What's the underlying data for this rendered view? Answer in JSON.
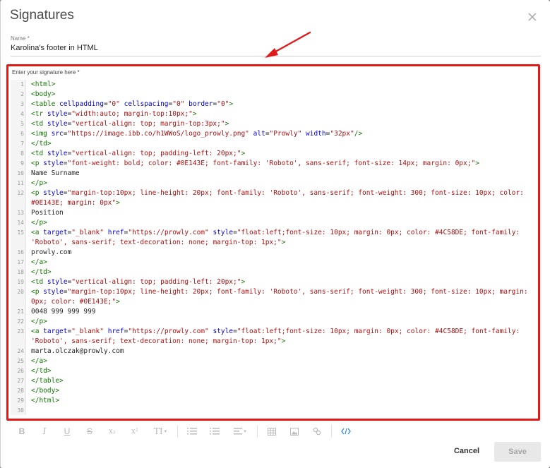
{
  "dialog": {
    "title": "Signatures",
    "name_label": "Name *",
    "name_value": "Karolina's footer in HTML",
    "signature_label": "Enter your signature here *"
  },
  "colors": {
    "highlight": "#e11919",
    "tag": "#117700",
    "attr": "#0000cc",
    "string": "#aa1111",
    "active_tool": "#3c8ee0"
  },
  "code": [
    {
      "n": "1",
      "parts": [
        {
          "k": "t",
          "v": "<html>"
        }
      ]
    },
    {
      "n": "2",
      "parts": [
        {
          "k": "t",
          "v": "<body>"
        }
      ]
    },
    {
      "n": "3",
      "parts": [
        {
          "k": "t",
          "v": "<table "
        },
        {
          "k": "a",
          "v": "cellpadding"
        },
        {
          "k": "",
          "v": "="
        },
        {
          "k": "s",
          "v": "\"0\""
        },
        {
          "k": "",
          "v": " "
        },
        {
          "k": "a",
          "v": "cellspacing"
        },
        {
          "k": "",
          "v": "="
        },
        {
          "k": "s",
          "v": "\"0\""
        },
        {
          "k": "",
          "v": " "
        },
        {
          "k": "a",
          "v": "border"
        },
        {
          "k": "",
          "v": "="
        },
        {
          "k": "s",
          "v": "\"0\""
        },
        {
          "k": "t",
          "v": ">"
        }
      ]
    },
    {
      "n": "4",
      "parts": [
        {
          "k": "t",
          "v": "<tr "
        },
        {
          "k": "a",
          "v": "style"
        },
        {
          "k": "",
          "v": "="
        },
        {
          "k": "s",
          "v": "\"width:auto; margin-top:10px;\""
        },
        {
          "k": "t",
          "v": ">"
        }
      ]
    },
    {
      "n": "5",
      "parts": [
        {
          "k": "t",
          "v": "<td "
        },
        {
          "k": "a",
          "v": "style"
        },
        {
          "k": "",
          "v": "="
        },
        {
          "k": "s",
          "v": "\"vertical-align: top; margin-top:3px;\""
        },
        {
          "k": "t",
          "v": ">"
        }
      ]
    },
    {
      "n": "6",
      "parts": [
        {
          "k": "t",
          "v": "<img "
        },
        {
          "k": "a",
          "v": "src"
        },
        {
          "k": "",
          "v": "="
        },
        {
          "k": "s",
          "v": "\"https://image.ibb.co/h1WWoS/logo_prowly.png\""
        },
        {
          "k": "",
          "v": " "
        },
        {
          "k": "a",
          "v": "alt"
        },
        {
          "k": "",
          "v": "="
        },
        {
          "k": "s",
          "v": "\"Prowly\""
        },
        {
          "k": "",
          "v": " "
        },
        {
          "k": "a",
          "v": "width"
        },
        {
          "k": "",
          "v": "="
        },
        {
          "k": "s",
          "v": "\"32px\""
        },
        {
          "k": "t",
          "v": "/>"
        }
      ]
    },
    {
      "n": "7",
      "parts": [
        {
          "k": "t",
          "v": "</td>"
        }
      ]
    },
    {
      "n": "8",
      "parts": [
        {
          "k": "t",
          "v": "<td "
        },
        {
          "k": "a",
          "v": "style"
        },
        {
          "k": "",
          "v": "="
        },
        {
          "k": "s",
          "v": "\"vertical-align: top; padding-left: 20px;\""
        },
        {
          "k": "t",
          "v": ">"
        }
      ]
    },
    {
      "n": "9",
      "parts": [
        {
          "k": "t",
          "v": "<p "
        },
        {
          "k": "a",
          "v": "style"
        },
        {
          "k": "",
          "v": "="
        },
        {
          "k": "s",
          "v": "\"font-weight: bold; color: #0E143E; font-family: 'Roboto', sans-serif; font-size: 14px; margin: 0px;\""
        },
        {
          "k": "t",
          "v": ">"
        }
      ]
    },
    {
      "n": "10",
      "parts": [
        {
          "k": "",
          "v": "Name Surname"
        }
      ]
    },
    {
      "n": "11",
      "parts": [
        {
          "k": "t",
          "v": "</p>"
        }
      ]
    },
    {
      "n": "12",
      "parts": [
        {
          "k": "t",
          "v": "<p "
        },
        {
          "k": "a",
          "v": "style"
        },
        {
          "k": "",
          "v": "="
        },
        {
          "k": "s",
          "v": "\"margin-top:10px; line-height: 20px; font-family: 'Roboto', sans-serif; font-weight: 300; font-size: 10px; color: #0E143E; margin: 0px\""
        },
        {
          "k": "t",
          "v": ">"
        }
      ]
    },
    {
      "n": "13",
      "parts": [
        {
          "k": "",
          "v": "Position"
        }
      ]
    },
    {
      "n": "14",
      "parts": [
        {
          "k": "t",
          "v": "</p>"
        }
      ]
    },
    {
      "n": "15",
      "parts": [
        {
          "k": "t",
          "v": "<a "
        },
        {
          "k": "a",
          "v": "target"
        },
        {
          "k": "",
          "v": "="
        },
        {
          "k": "s",
          "v": "\"_blank\""
        },
        {
          "k": "",
          "v": " "
        },
        {
          "k": "a",
          "v": "href"
        },
        {
          "k": "",
          "v": "="
        },
        {
          "k": "s",
          "v": "\"https://prowly.com\""
        },
        {
          "k": "",
          "v": " "
        },
        {
          "k": "a",
          "v": "style"
        },
        {
          "k": "",
          "v": "="
        },
        {
          "k": "s",
          "v": "\"float:left;font-size: 10px; margin: 0px; color: #4C58DE; font-family: 'Roboto', sans-serif; text-decoration: none; margin-top: 1px;\""
        },
        {
          "k": "t",
          "v": ">"
        }
      ]
    },
    {
      "n": "16",
      "parts": [
        {
          "k": "",
          "v": "prowly.com"
        }
      ]
    },
    {
      "n": "17",
      "parts": [
        {
          "k": "t",
          "v": "</a>"
        }
      ]
    },
    {
      "n": "18",
      "parts": [
        {
          "k": "t",
          "v": "</td>"
        }
      ]
    },
    {
      "n": "19",
      "parts": [
        {
          "k": "t",
          "v": "<td "
        },
        {
          "k": "a",
          "v": "style"
        },
        {
          "k": "",
          "v": "="
        },
        {
          "k": "s",
          "v": "\"vertical-align: top; padding-left: 20px;\""
        },
        {
          "k": "t",
          "v": ">"
        }
      ]
    },
    {
      "n": "20",
      "parts": [
        {
          "k": "t",
          "v": "<p "
        },
        {
          "k": "a",
          "v": "style"
        },
        {
          "k": "",
          "v": "="
        },
        {
          "k": "s",
          "v": "\"margin-top:10px; line-height: 20px; font-family: 'Roboto', sans-serif; font-weight: 300; font-size: 10px; margin: 0px; color: #0E143E;\""
        },
        {
          "k": "t",
          "v": ">"
        }
      ]
    },
    {
      "n": "21",
      "parts": [
        {
          "k": "",
          "v": "0048 999 999 999"
        }
      ]
    },
    {
      "n": "22",
      "parts": [
        {
          "k": "t",
          "v": "</p>"
        }
      ]
    },
    {
      "n": "23",
      "parts": [
        {
          "k": "t",
          "v": "<a "
        },
        {
          "k": "a",
          "v": "target"
        },
        {
          "k": "",
          "v": "="
        },
        {
          "k": "s",
          "v": "\"_blank\""
        },
        {
          "k": "",
          "v": " "
        },
        {
          "k": "a",
          "v": "href"
        },
        {
          "k": "",
          "v": "="
        },
        {
          "k": "s",
          "v": "\"https://prowly.com\""
        },
        {
          "k": "",
          "v": " "
        },
        {
          "k": "a",
          "v": "style"
        },
        {
          "k": "",
          "v": "="
        },
        {
          "k": "s",
          "v": "\"float:left;font-size: 10px; margin: 0px; color: #4C58DE; font-family: 'Roboto', sans-serif; text-decoration: none; margin-top: 1px;\""
        },
        {
          "k": "t",
          "v": ">"
        }
      ]
    },
    {
      "n": "24",
      "parts": [
        {
          "k": "",
          "v": "marta.olczak@prowly.com"
        }
      ]
    },
    {
      "n": "25",
      "parts": [
        {
          "k": "t",
          "v": "</a>"
        }
      ]
    },
    {
      "n": "26",
      "parts": [
        {
          "k": "t",
          "v": "</td>"
        }
      ]
    },
    {
      "n": "27",
      "parts": [
        {
          "k": "t",
          "v": "</table>"
        }
      ]
    },
    {
      "n": "28",
      "parts": [
        {
          "k": "t",
          "v": "</body>"
        }
      ]
    },
    {
      "n": "29",
      "parts": [
        {
          "k": "t",
          "v": "</html>"
        }
      ]
    },
    {
      "n": "30",
      "parts": []
    }
  ],
  "toolbar": {
    "bold": "B",
    "italic": "I",
    "underline": "U",
    "strike": "S",
    "subscript": "x₂",
    "superscript": "x²",
    "text_size": "TI",
    "icons": [
      "bold-icon",
      "italic-icon",
      "underline-icon",
      "strikethrough-icon",
      "subscript-icon",
      "superscript-icon",
      "text-size-icon",
      "ordered-list-icon",
      "unordered-list-icon",
      "align-icon",
      "table-icon",
      "image-icon",
      "link-icon",
      "code-view-icon"
    ]
  },
  "actions": {
    "cancel": "Cancel",
    "save": "Save"
  }
}
